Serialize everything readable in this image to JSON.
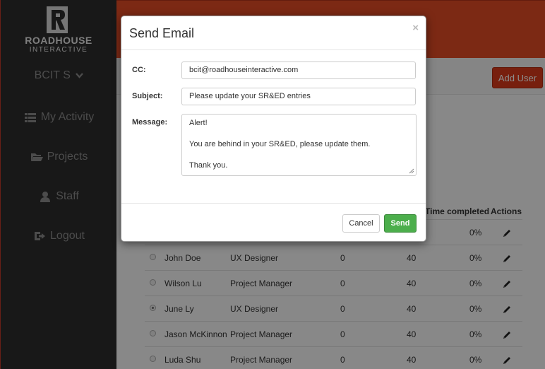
{
  "brand": {
    "name": "ROADHOUSE",
    "sub": "INTERACTIVE"
  },
  "sidebar": {
    "company": "BCIT S",
    "items": [
      {
        "label": "My Activity",
        "icon": "list-icon"
      },
      {
        "label": "Projects",
        "icon": "folder-icon"
      },
      {
        "label": "Staff",
        "icon": "user-icon"
      },
      {
        "label": "Logout",
        "icon": "logout-icon"
      }
    ]
  },
  "toolbar": {
    "add_user_label": "Add User"
  },
  "table": {
    "headers": {
      "time_completed": "Time completed",
      "actions": "Actions"
    },
    "first_row_pct": "0%",
    "rows": [
      {
        "name": "John Doe",
        "role": "UX Designer",
        "hours": "0",
        "budget": "40",
        "pct": "0%",
        "selected": false
      },
      {
        "name": "Wilson Lu",
        "role": "Project Manager",
        "hours": "0",
        "budget": "40",
        "pct": "0%",
        "selected": false
      },
      {
        "name": "June Ly",
        "role": "UX Designer",
        "hours": "0",
        "budget": "40",
        "pct": "0%",
        "selected": true
      },
      {
        "name": "Jason McKinnon",
        "role": "Project Manager",
        "hours": "0",
        "budget": "40",
        "pct": "0%",
        "selected": false
      },
      {
        "name": "Luda Shu",
        "role": "Project Manager",
        "hours": "0",
        "budget": "40",
        "pct": "0%",
        "selected": false
      }
    ]
  },
  "modal": {
    "title": "Send Email",
    "close": "×",
    "cc_label": "CC:",
    "cc_value": "bcit@roadhouseinteractive.com",
    "subject_label": "Subject:",
    "subject_value": "Please update your SR&ED entries",
    "message_label": "Message:",
    "message_lines": [
      "Alert!",
      "",
      "You are behind in your SR&ED, please update them.",
      "",
      "Thank you."
    ],
    "cancel_label": "Cancel",
    "send_label": "Send"
  },
  "colors": {
    "accent": "#e24b26",
    "sidebar": "#2d2d2d",
    "send": "#4cae4c",
    "add_user": "#d9391a"
  }
}
